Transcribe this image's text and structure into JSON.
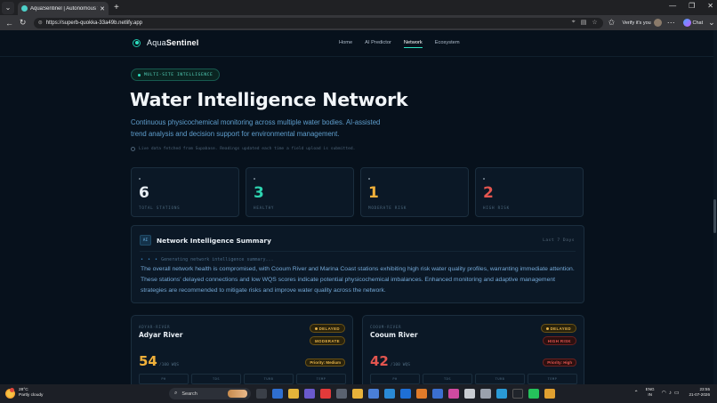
{
  "browser": {
    "tab_title": "AquaSentinel | Autonomous Wate",
    "tab_close": "✕",
    "new_tab": "+",
    "url": "https://superb-quokka-33a49b.netlify.app",
    "verify_label": "Verify it's you",
    "chat_label": "Chat",
    "win_min": "—",
    "win_max": "❐",
    "win_close": "✕"
  },
  "site": {
    "brand_light": "Aqua",
    "brand_bold": "Sentinel",
    "nav": [
      "Home",
      "AI Predictor",
      "Network",
      "Ecosystem"
    ],
    "active_nav": "Network"
  },
  "hero": {
    "chip": "MULTI-SITE INTELLIGENCE",
    "title": "Water Intelligence Network",
    "subtitle": "Continuous physicochemical monitoring across multiple water bodies. AI-assisted trend analysis and decision support for environmental management.",
    "live_note": "Live data fetched from Supabase. Readings updated each time a field upload is submitted."
  },
  "stats": [
    {
      "value": "6",
      "label": "TOTAL STATIONS",
      "color": "#e8eef4"
    },
    {
      "value": "3",
      "label": "HEALTHY",
      "color": "#2ed3b0"
    },
    {
      "value": "1",
      "label": "MODERATE RISK",
      "color": "#f0b03a"
    },
    {
      "value": "2",
      "label": "HIGH RISK",
      "color": "#e3554f"
    }
  ],
  "summary": {
    "badge": "AI",
    "title": "Network Intelligence Summary",
    "range": "Last 7 Days",
    "generating": "Generating network intelligence summary...",
    "text": "The overall network health is compromised, with Cooum River and Marina Coast stations exhibiting high risk water quality profiles, warranting immediate attention. These stations' delayed connections and low WQS scores indicate potential physicochemical imbalances. Enhanced monitoring and adaptive management strategies are recommended to mitigate risks and improve water quality across the network."
  },
  "stations": [
    {
      "type": "ADYAR-RIVER",
      "name": "Adyar River",
      "status": "DELAYED",
      "risk": "MODERATE",
      "score": "54",
      "score_unit": "/100 WQS",
      "score_color": "#f0b03a",
      "priority": "Priority: Medium",
      "params": [
        "PH",
        "TDS",
        "TURB",
        "TEMP"
      ]
    },
    {
      "type": "COOUM-RIVER",
      "name": "Cooum River",
      "status": "DELAYED",
      "risk": "HIGH RISK",
      "score": "42",
      "score_unit": "/100 WQS",
      "score_color": "#e3554f",
      "priority": "Priority: High",
      "params": [
        "PH",
        "TDS",
        "TURB",
        "TEMP"
      ]
    }
  ],
  "taskbar": {
    "temp": "28°C",
    "condition": "Partly cloudy",
    "search": "Search",
    "lang1": "ENG",
    "lang2": "IN",
    "time": "23:55",
    "date": "21-07-2026"
  }
}
